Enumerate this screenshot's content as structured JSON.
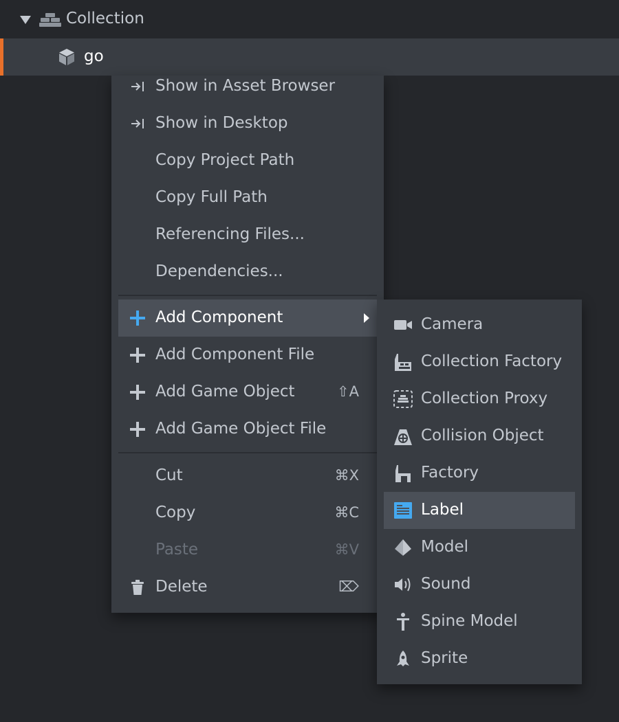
{
  "tree": {
    "root_label": "Collection",
    "child_label": "go"
  },
  "menu": {
    "items": [
      {
        "label": "Show in Asset Browser",
        "icon": "show-in-icon"
      },
      {
        "label": "Show in Desktop",
        "icon": "show-in-icon"
      },
      {
        "label": "Copy Project Path"
      },
      {
        "label": "Copy Full Path"
      },
      {
        "label": "Referencing Files..."
      },
      {
        "label": "Dependencies..."
      },
      {
        "label": "Add Component",
        "icon": "plus-icon",
        "submenu": true
      },
      {
        "label": "Add Component File",
        "icon": "plus-icon"
      },
      {
        "label": "Add Game Object",
        "icon": "plus-icon",
        "shortcut": "⇧A"
      },
      {
        "label": "Add Game Object File",
        "icon": "plus-icon"
      },
      {
        "label": "Cut",
        "shortcut": "⌘X"
      },
      {
        "label": "Copy",
        "shortcut": "⌘C"
      },
      {
        "label": "Paste",
        "shortcut": "⌘V",
        "disabled": true
      },
      {
        "label": "Delete",
        "icon": "trash-icon",
        "shortcut": "⌦"
      }
    ]
  },
  "submenu": {
    "items": [
      {
        "label": "Camera",
        "icon": "camera-icon"
      },
      {
        "label": "Collection Factory",
        "icon": "collection-factory-icon"
      },
      {
        "label": "Collection Proxy",
        "icon": "collection-proxy-icon"
      },
      {
        "label": "Collision Object",
        "icon": "collision-object-icon"
      },
      {
        "label": "Factory",
        "icon": "factory-icon"
      },
      {
        "label": "Label",
        "icon": "label-icon"
      },
      {
        "label": "Model",
        "icon": "model-icon"
      },
      {
        "label": "Sound",
        "icon": "sound-icon"
      },
      {
        "label": "Spine Model",
        "icon": "spine-model-icon"
      },
      {
        "label": "Sprite",
        "icon": "sprite-icon"
      }
    ]
  },
  "colors": {
    "background": "#25272b",
    "menu": "#383c42",
    "hover": "#4b5058",
    "accent_orange": "#e8702a",
    "accent_blue": "#45a9f0"
  }
}
